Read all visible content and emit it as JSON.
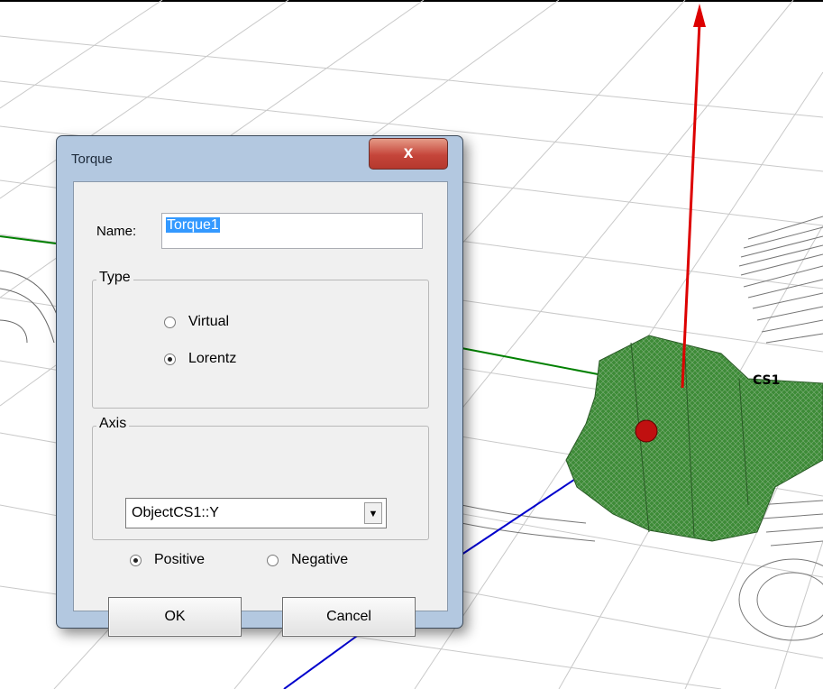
{
  "viewport": {
    "cs_label": "CS1"
  },
  "dialog": {
    "title": "Torque",
    "close_glyph": "x",
    "name_label": "Name:",
    "name_value": "Torque1",
    "type_group": {
      "legend": "Type",
      "options": [
        {
          "label": "Virtual",
          "selected": false
        },
        {
          "label": "Lorentz",
          "selected": true
        }
      ]
    },
    "axis_group": {
      "legend": "Axis",
      "selected_axis": "ObjectCS1::Y",
      "options": [
        {
          "label": "Positive",
          "selected": true
        },
        {
          "label": "Negative",
          "selected": false
        }
      ]
    },
    "buttons": {
      "ok": "OK",
      "cancel": "Cancel"
    }
  },
  "colors": {
    "x_axis": "#cc0000",
    "y_axis": "#008000",
    "z_axis": "#0000cc",
    "model": "#3d8b37",
    "dialog_frame": "#b3c8e0",
    "close_button": "#c5453a"
  }
}
